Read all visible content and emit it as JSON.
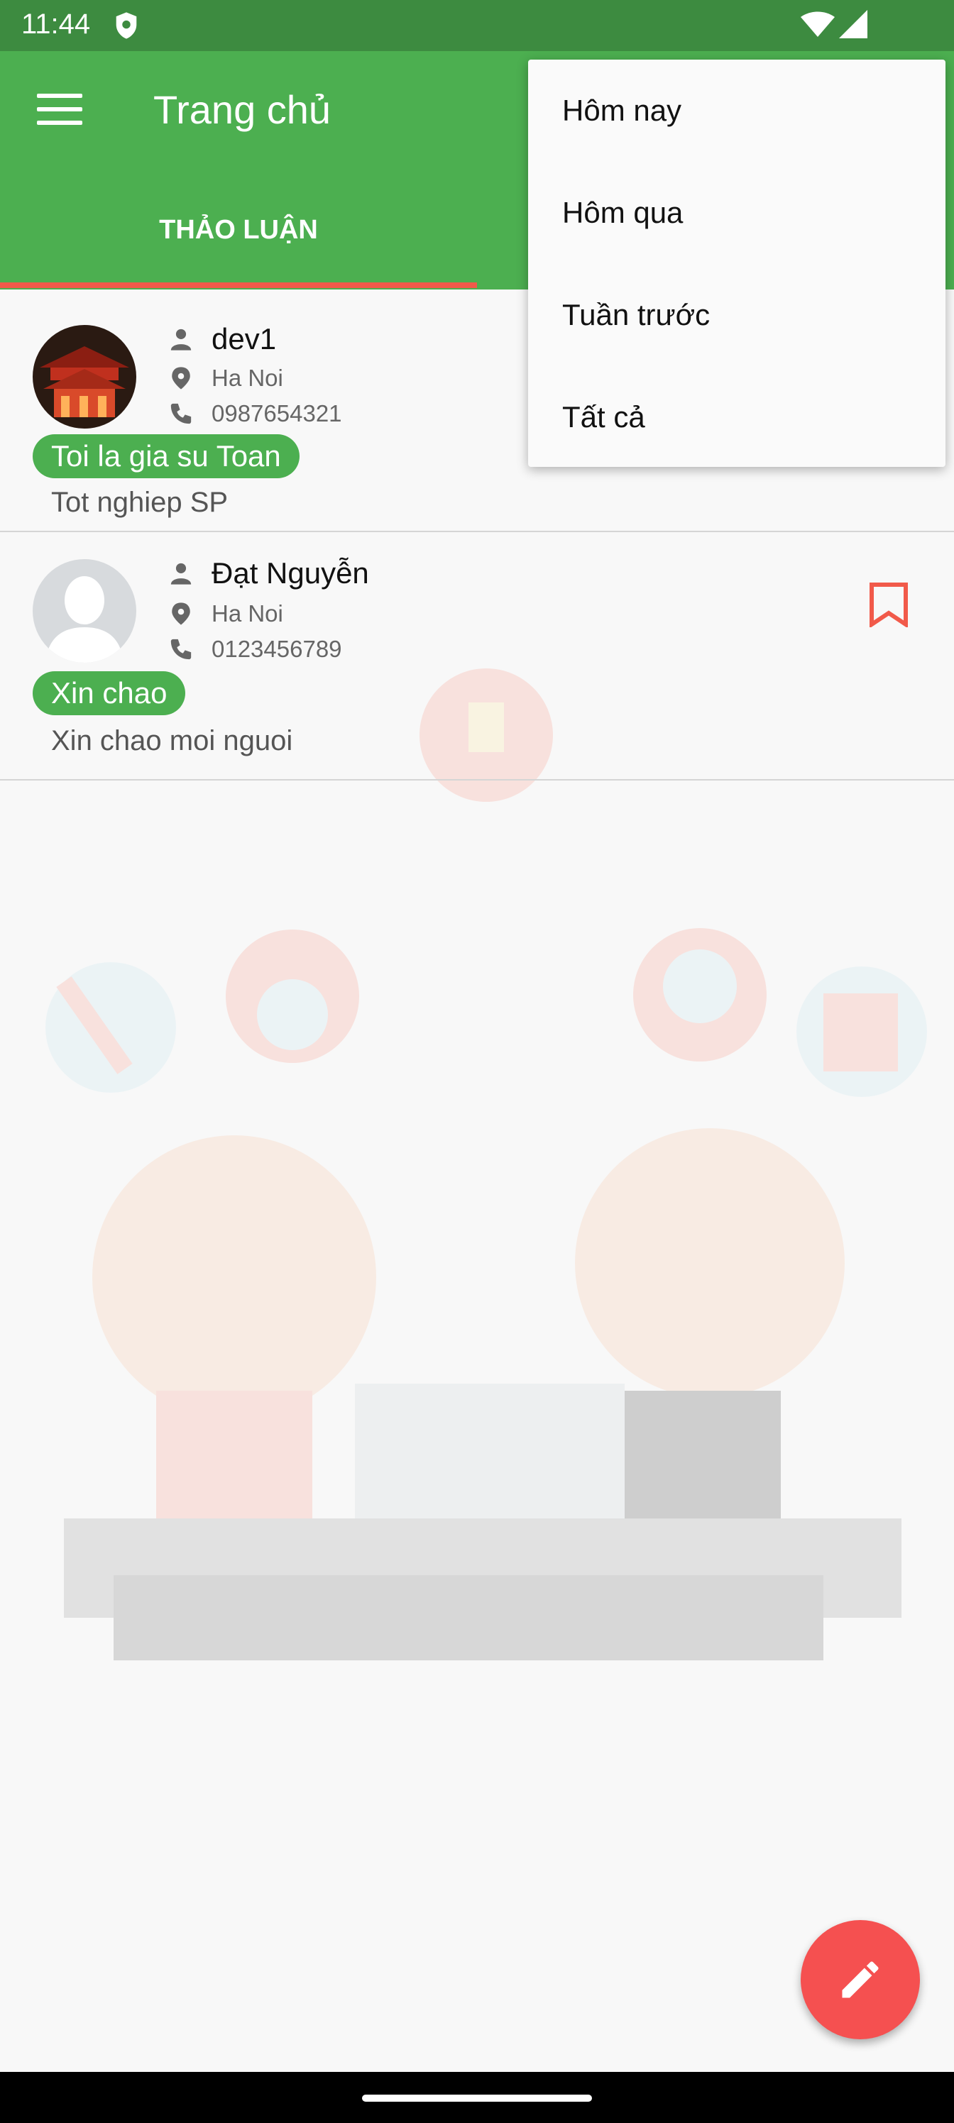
{
  "status_bar": {
    "time": "11:44",
    "icons": [
      "shield-icon",
      "wifi-icon",
      "signal-icon"
    ]
  },
  "app_bar": {
    "title": "Trang chủ",
    "menu_icon": "hamburger-icon"
  },
  "tabs": [
    {
      "label": "THẢO LUẬN",
      "selected": true
    }
  ],
  "colors": {
    "primary": "#4caf50",
    "status_bar": "#3d8b40",
    "accent": "#f55050",
    "indicator": "#f15a4a"
  },
  "posts": [
    {
      "name": "dev1",
      "location": "Ha Noi",
      "phone": "0987654321",
      "tag": "Toi la gia su Toan",
      "description": "Tot nghiep SP",
      "bookmarked": false
    },
    {
      "name": "Đạt Nguyễn",
      "location": "Ha Noi",
      "phone": "0123456789",
      "tag": "Xin chao",
      "description": "Xin chao moi nguoi",
      "bookmarked": true
    }
  ],
  "popup_menu": {
    "items": [
      "Hôm nay",
      "Hôm qua",
      "Tuần trước",
      "Tất cả"
    ]
  },
  "fab": {
    "icon": "pencil-icon"
  }
}
